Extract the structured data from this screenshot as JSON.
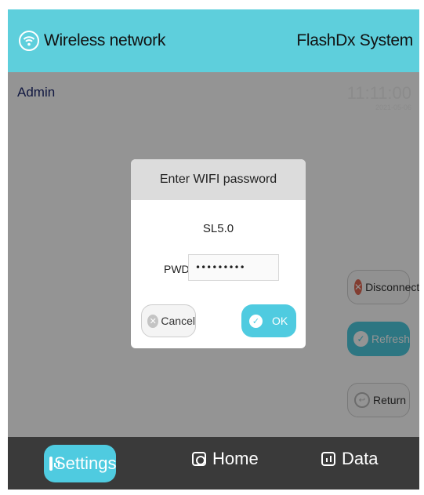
{
  "header": {
    "wifi_icon": "wifi-icon",
    "title": "Wireless network",
    "system": "FlashDx System"
  },
  "main": {
    "user": "Admin",
    "time": "11:11:00",
    "date": "2021-05-06"
  },
  "side_buttons": {
    "disconnect": "Disconnect",
    "refresh": "Refresh",
    "return": "Return"
  },
  "dialog": {
    "title": "Enter WIFI password",
    "ssid": "SL5.0",
    "pwd_label": "PWD",
    "pwd_value": "•••••••••",
    "cancel": "Cancel",
    "ok": "OK"
  },
  "footer": {
    "settings": "Settings",
    "home": "Home",
    "data": "Data"
  },
  "colors": {
    "accent": "#5ecfdc",
    "danger": "#e06a55",
    "footer": "#3a3a3a"
  }
}
